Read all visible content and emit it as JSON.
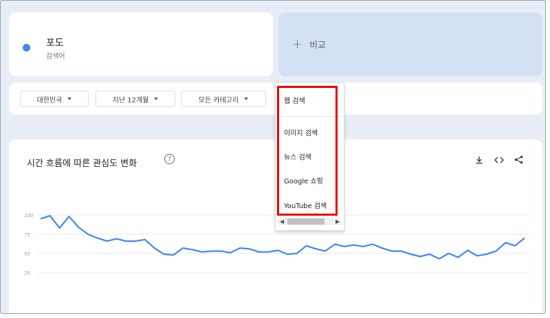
{
  "term": {
    "name": "포도",
    "type_label": "검색어",
    "color": "#4285f4"
  },
  "compare": {
    "plus": "+",
    "label": "비교"
  },
  "filters": [
    {
      "label": "대한민국"
    },
    {
      "label": "지난 12개월"
    },
    {
      "label": "모든 카테고리"
    }
  ],
  "search_type_menu": {
    "items": [
      "웹 검색",
      "이미지 검색",
      "뉴스 검색",
      "Google 쇼핑",
      "YouTube 검색"
    ]
  },
  "chart": {
    "title": "시간 흐름에 따른 관심도 변화",
    "help": "?",
    "tools": [
      "download-icon",
      "embed-icon",
      "share-icon"
    ]
  },
  "chart_data": {
    "type": "line",
    "ylim": [
      0,
      100
    ],
    "yticks": [
      100,
      75,
      50,
      25
    ],
    "grid": true,
    "legend": "none",
    "series": [
      {
        "color": "#4285f4",
        "values": [
          95,
          99,
          83,
          98,
          84,
          75,
          70,
          66,
          69,
          66,
          66,
          68,
          57,
          49,
          48,
          57,
          55,
          52,
          53,
          53,
          51,
          57,
          56,
          52,
          52,
          54,
          49,
          50,
          60,
          56,
          53,
          62,
          59,
          61,
          59,
          62,
          57,
          53,
          53,
          49,
          46,
          49,
          43,
          50,
          45,
          54,
          47,
          49,
          53,
          64,
          60,
          70
        ]
      }
    ]
  }
}
